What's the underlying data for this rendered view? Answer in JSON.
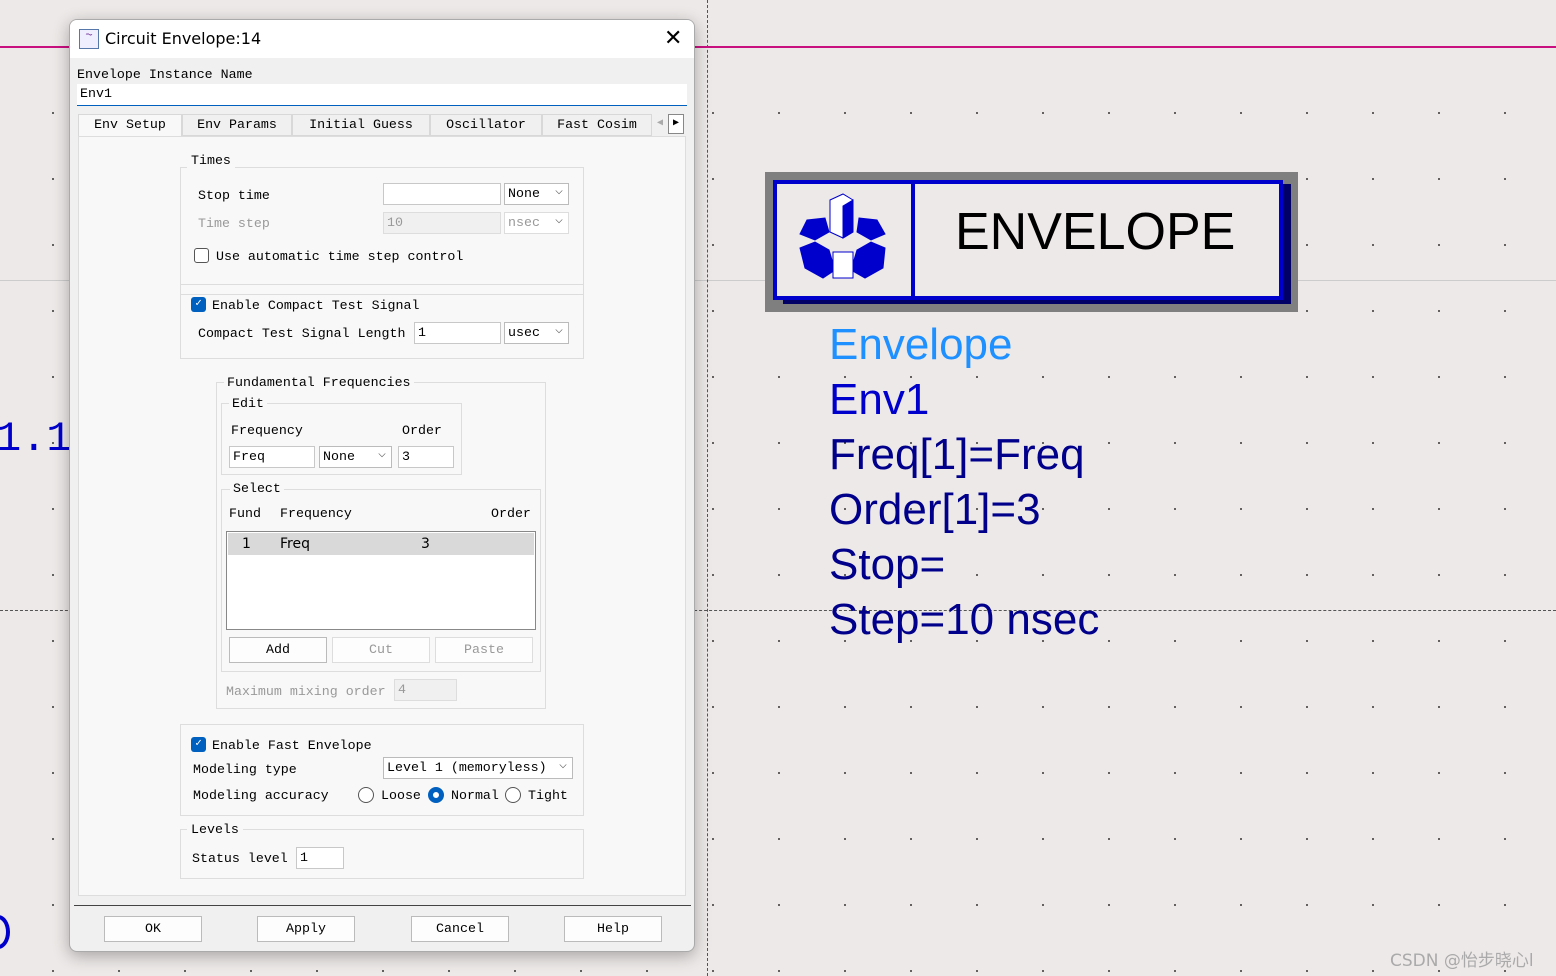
{
  "dialog": {
    "title": "Circuit Envelope:14",
    "instance_label": "Envelope Instance Name",
    "instance_value": "Env1",
    "tabs": [
      "Env Setup",
      "Env Params",
      "Initial Guess",
      "Oscillator",
      "Fast Cosim"
    ],
    "times": {
      "legend": "Times",
      "stop_label": "Stop time",
      "stop_value": "",
      "stop_unit": "None",
      "step_label": "Time step",
      "step_value": "10",
      "step_unit": "nsec",
      "auto_label": "Use automatic time step control",
      "auto_checked": false
    },
    "compact": {
      "enable_label": "Enable Compact Test Signal",
      "enable_checked": true,
      "length_label": "Compact Test Signal Length",
      "length_value": "1",
      "length_unit": "usec"
    },
    "fund": {
      "legend": "Fundamental Frequencies",
      "edit_legend": "Edit",
      "freq_label": "Frequency",
      "order_label": "Order",
      "freq_value": "Freq",
      "freq_unit": "None",
      "order_value": "3",
      "select_legend": "Select",
      "col_fund": "Fund",
      "col_freq": "Frequency",
      "col_order": "Order",
      "rows": [
        {
          "fund": "1",
          "freq": "Freq",
          "order": "3"
        }
      ],
      "add": "Add",
      "cut": "Cut",
      "paste": "Paste",
      "max_mix_label": "Maximum mixing order",
      "max_mix_value": "4"
    },
    "fast": {
      "enable_label": "Enable Fast Envelope",
      "enable_checked": true,
      "type_label": "Modeling type",
      "type_value": "Level 1 (memoryless)",
      "acc_label": "Modeling accuracy",
      "acc_options": [
        "Loose",
        "Normal",
        "Tight"
      ],
      "acc_selected": "Normal"
    },
    "levels": {
      "legend": "Levels",
      "status_label": "Status level",
      "status_value": "1"
    },
    "buttons": {
      "ok": "OK",
      "apply": "Apply",
      "cancel": "Cancel",
      "help": "Help"
    }
  },
  "schematic": {
    "symbol_title": "ENVELOPE",
    "lines": [
      "Envelope",
      "Env1",
      "Freq[1]=Freq",
      "Order[1]=3",
      "Stop=",
      "Step=10 nsec"
    ],
    "left_text": "1.1",
    "colors": {
      "wire": "#c8107f",
      "blue": "#0000cc",
      "navy": "#00008b",
      "light": "#1e90ff"
    }
  },
  "watermark": "CSDN @怡步晓心l"
}
